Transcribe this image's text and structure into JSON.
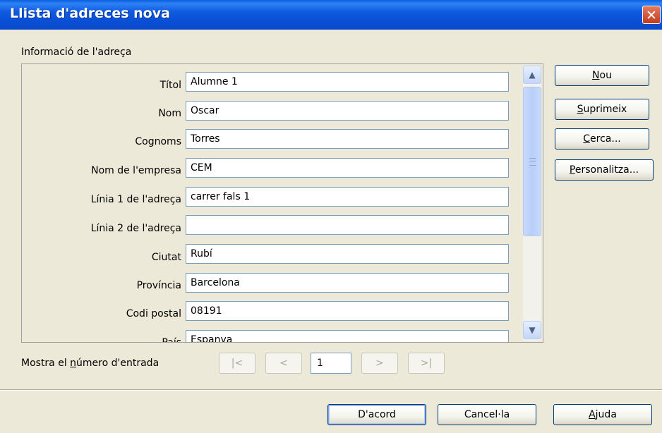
{
  "window": {
    "title": "Llista d'adreces nova",
    "close_glyph": "✕"
  },
  "section_label": "Informació de l'adreça",
  "fields": [
    {
      "label": "Títol",
      "value": "Alumne 1"
    },
    {
      "label": "Nom",
      "value": "Oscar"
    },
    {
      "label": "Cognoms",
      "value": "Torres"
    },
    {
      "label": "Nom de l'empresa",
      "value": "CEM"
    },
    {
      "label": "Línia 1 de l'adreça",
      "value": "carrer fals 1"
    },
    {
      "label": "Línia 2 de l'adreça",
      "value": ""
    },
    {
      "label": "Ciutat",
      "value": "Rubí"
    },
    {
      "label": "Província",
      "value": "Barcelona"
    },
    {
      "label": "Codi postal",
      "value": "08191"
    },
    {
      "label": "País",
      "value": "Espanya"
    }
  ],
  "side_buttons": {
    "new": {
      "prefix": "",
      "mnemonic": "N",
      "rest": "ou"
    },
    "delete": {
      "prefix": "",
      "mnemonic": "S",
      "rest": "uprimeix"
    },
    "find": {
      "prefix": "",
      "mnemonic": "C",
      "rest": "erca..."
    },
    "customize": {
      "prefix": "",
      "mnemonic": "P",
      "rest": "ersonalitza..."
    }
  },
  "entry_nav": {
    "label_prefix": "Mostra el ",
    "label_mnemonic": "n",
    "label_rest": "úmero d'entrada",
    "first": "|<",
    "prev": "<",
    "current": "1",
    "next": ">",
    "last": ">|"
  },
  "scrollbar": {
    "up_glyph": "▲",
    "down_glyph": "▼",
    "position": 0.0
  },
  "footer_buttons": {
    "ok": "D'acord",
    "cancel": "Cancel·la",
    "help": {
      "mnemonic": "A",
      "rest": "juda"
    }
  },
  "colors": {
    "titlebar": "#0A55DE",
    "dialog_bg": "#ECE9D8",
    "field_border": "#7F9DB9"
  }
}
